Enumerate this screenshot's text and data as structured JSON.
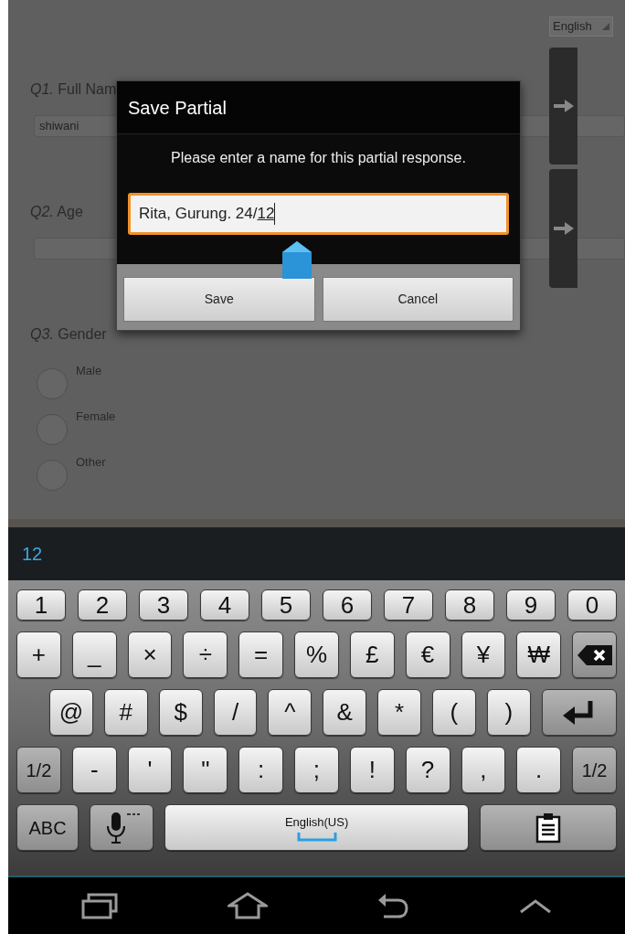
{
  "language_selector": {
    "label": "English"
  },
  "form": {
    "questions": [
      {
        "number": "Q1.",
        "label": "Full Nam",
        "kind": "text",
        "value": "shiwani"
      },
      {
        "number": "Q2.",
        "label": "Age",
        "kind": "text"
      },
      {
        "number": "Q3.",
        "label": "Gender",
        "kind": "radio",
        "options": [
          {
            "label": "Male",
            "selected": false
          },
          {
            "label": "Female",
            "selected": false
          },
          {
            "label": "Other",
            "selected": false
          }
        ]
      }
    ]
  },
  "dialog": {
    "title": "Save Partial",
    "message": "Please enter a name for this partial response.",
    "value": "Rita, Gurung. 24/",
    "composing": "12",
    "buttons": [
      "Save",
      "Cancel"
    ]
  },
  "suggestion": "12",
  "keyboard": {
    "key_rows": [
      {
        "keys": [
          {
            "kind": "char",
            "label": "1"
          },
          {
            "kind": "char",
            "label": "2"
          },
          {
            "kind": "char",
            "label": "3"
          },
          {
            "kind": "char",
            "label": "4"
          },
          {
            "kind": "char",
            "label": "5"
          },
          {
            "kind": "char",
            "label": "6"
          },
          {
            "kind": "char",
            "label": "7"
          },
          {
            "kind": "char",
            "label": "8"
          },
          {
            "kind": "char",
            "label": "9"
          },
          {
            "kind": "char",
            "label": "0"
          }
        ]
      },
      {
        "keys": [
          {
            "kind": "char",
            "label": "+"
          },
          {
            "kind": "char",
            "label": "_"
          },
          {
            "kind": "char",
            "label": "×"
          },
          {
            "kind": "char",
            "label": "÷"
          },
          {
            "kind": "char",
            "label": "="
          },
          {
            "kind": "char",
            "label": "%"
          },
          {
            "kind": "char",
            "label": "£"
          },
          {
            "kind": "char",
            "label": "€"
          },
          {
            "kind": "char",
            "label": "¥"
          },
          {
            "kind": "char",
            "label": "₩"
          },
          {
            "kind": "backspace"
          }
        ]
      },
      {
        "keys": [
          {
            "kind": "char",
            "label": "@"
          },
          {
            "kind": "char",
            "label": "#"
          },
          {
            "kind": "char",
            "label": "$"
          },
          {
            "kind": "char",
            "label": "/"
          },
          {
            "kind": "char",
            "label": "^"
          },
          {
            "kind": "char",
            "label": "&"
          },
          {
            "kind": "char",
            "label": "*"
          },
          {
            "kind": "char",
            "label": "("
          },
          {
            "kind": "char",
            "label": ")"
          },
          {
            "kind": "enter"
          }
        ]
      },
      {
        "keys": [
          {
            "kind": "function",
            "label": "1/2"
          },
          {
            "kind": "char",
            "label": "-"
          },
          {
            "kind": "char",
            "label": "'"
          },
          {
            "kind": "char",
            "label": "\""
          },
          {
            "kind": "char",
            "label": ":"
          },
          {
            "kind": "char",
            "label": ";"
          },
          {
            "kind": "char",
            "label": "!"
          },
          {
            "kind": "char",
            "label": "?"
          },
          {
            "kind": "char",
            "label": ","
          },
          {
            "kind": "char",
            "label": "."
          },
          {
            "kind": "function",
            "label": "1/2"
          }
        ]
      },
      {
        "keys": [
          {
            "kind": "function",
            "label": "ABC"
          },
          {
            "kind": "mic"
          },
          {
            "kind": "space",
            "label": "English(US)"
          },
          {
            "kind": "clipboard"
          }
        ]
      }
    ]
  }
}
